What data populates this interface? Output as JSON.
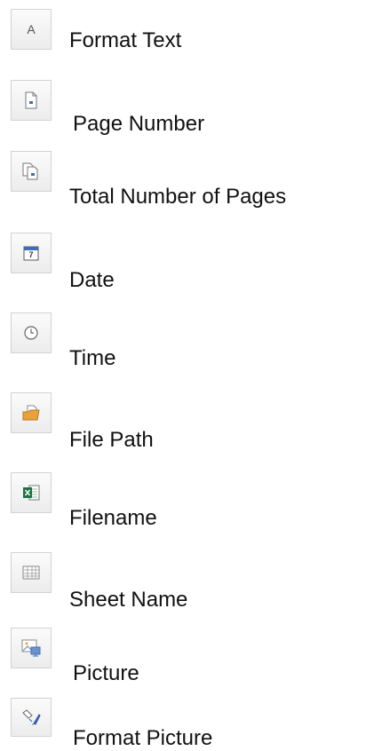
{
  "items": [
    {
      "label": "Format Text",
      "icon": "format-text-icon"
    },
    {
      "label": "Page Number",
      "icon": "page-number-icon"
    },
    {
      "label": "Total Number of Pages",
      "icon": "total-pages-icon"
    },
    {
      "label": "Date",
      "icon": "calendar-icon"
    },
    {
      "label": "Time",
      "icon": "clock-icon"
    },
    {
      "label": "File Path",
      "icon": "folder-icon"
    },
    {
      "label": "Filename",
      "icon": "excel-file-icon"
    },
    {
      "label": "Sheet Name",
      "icon": "sheet-grid-icon"
    },
    {
      "label": "Picture",
      "icon": "picture-icon"
    },
    {
      "label": "Format Picture",
      "icon": "format-picture-icon"
    }
  ],
  "icon_glyphs": {
    "format_text": "A",
    "date_day": "7"
  },
  "colors": {
    "icon_blue": "#3d6fb6",
    "folder_orange": "#e9a23b",
    "excel_green": "#1e7145"
  }
}
